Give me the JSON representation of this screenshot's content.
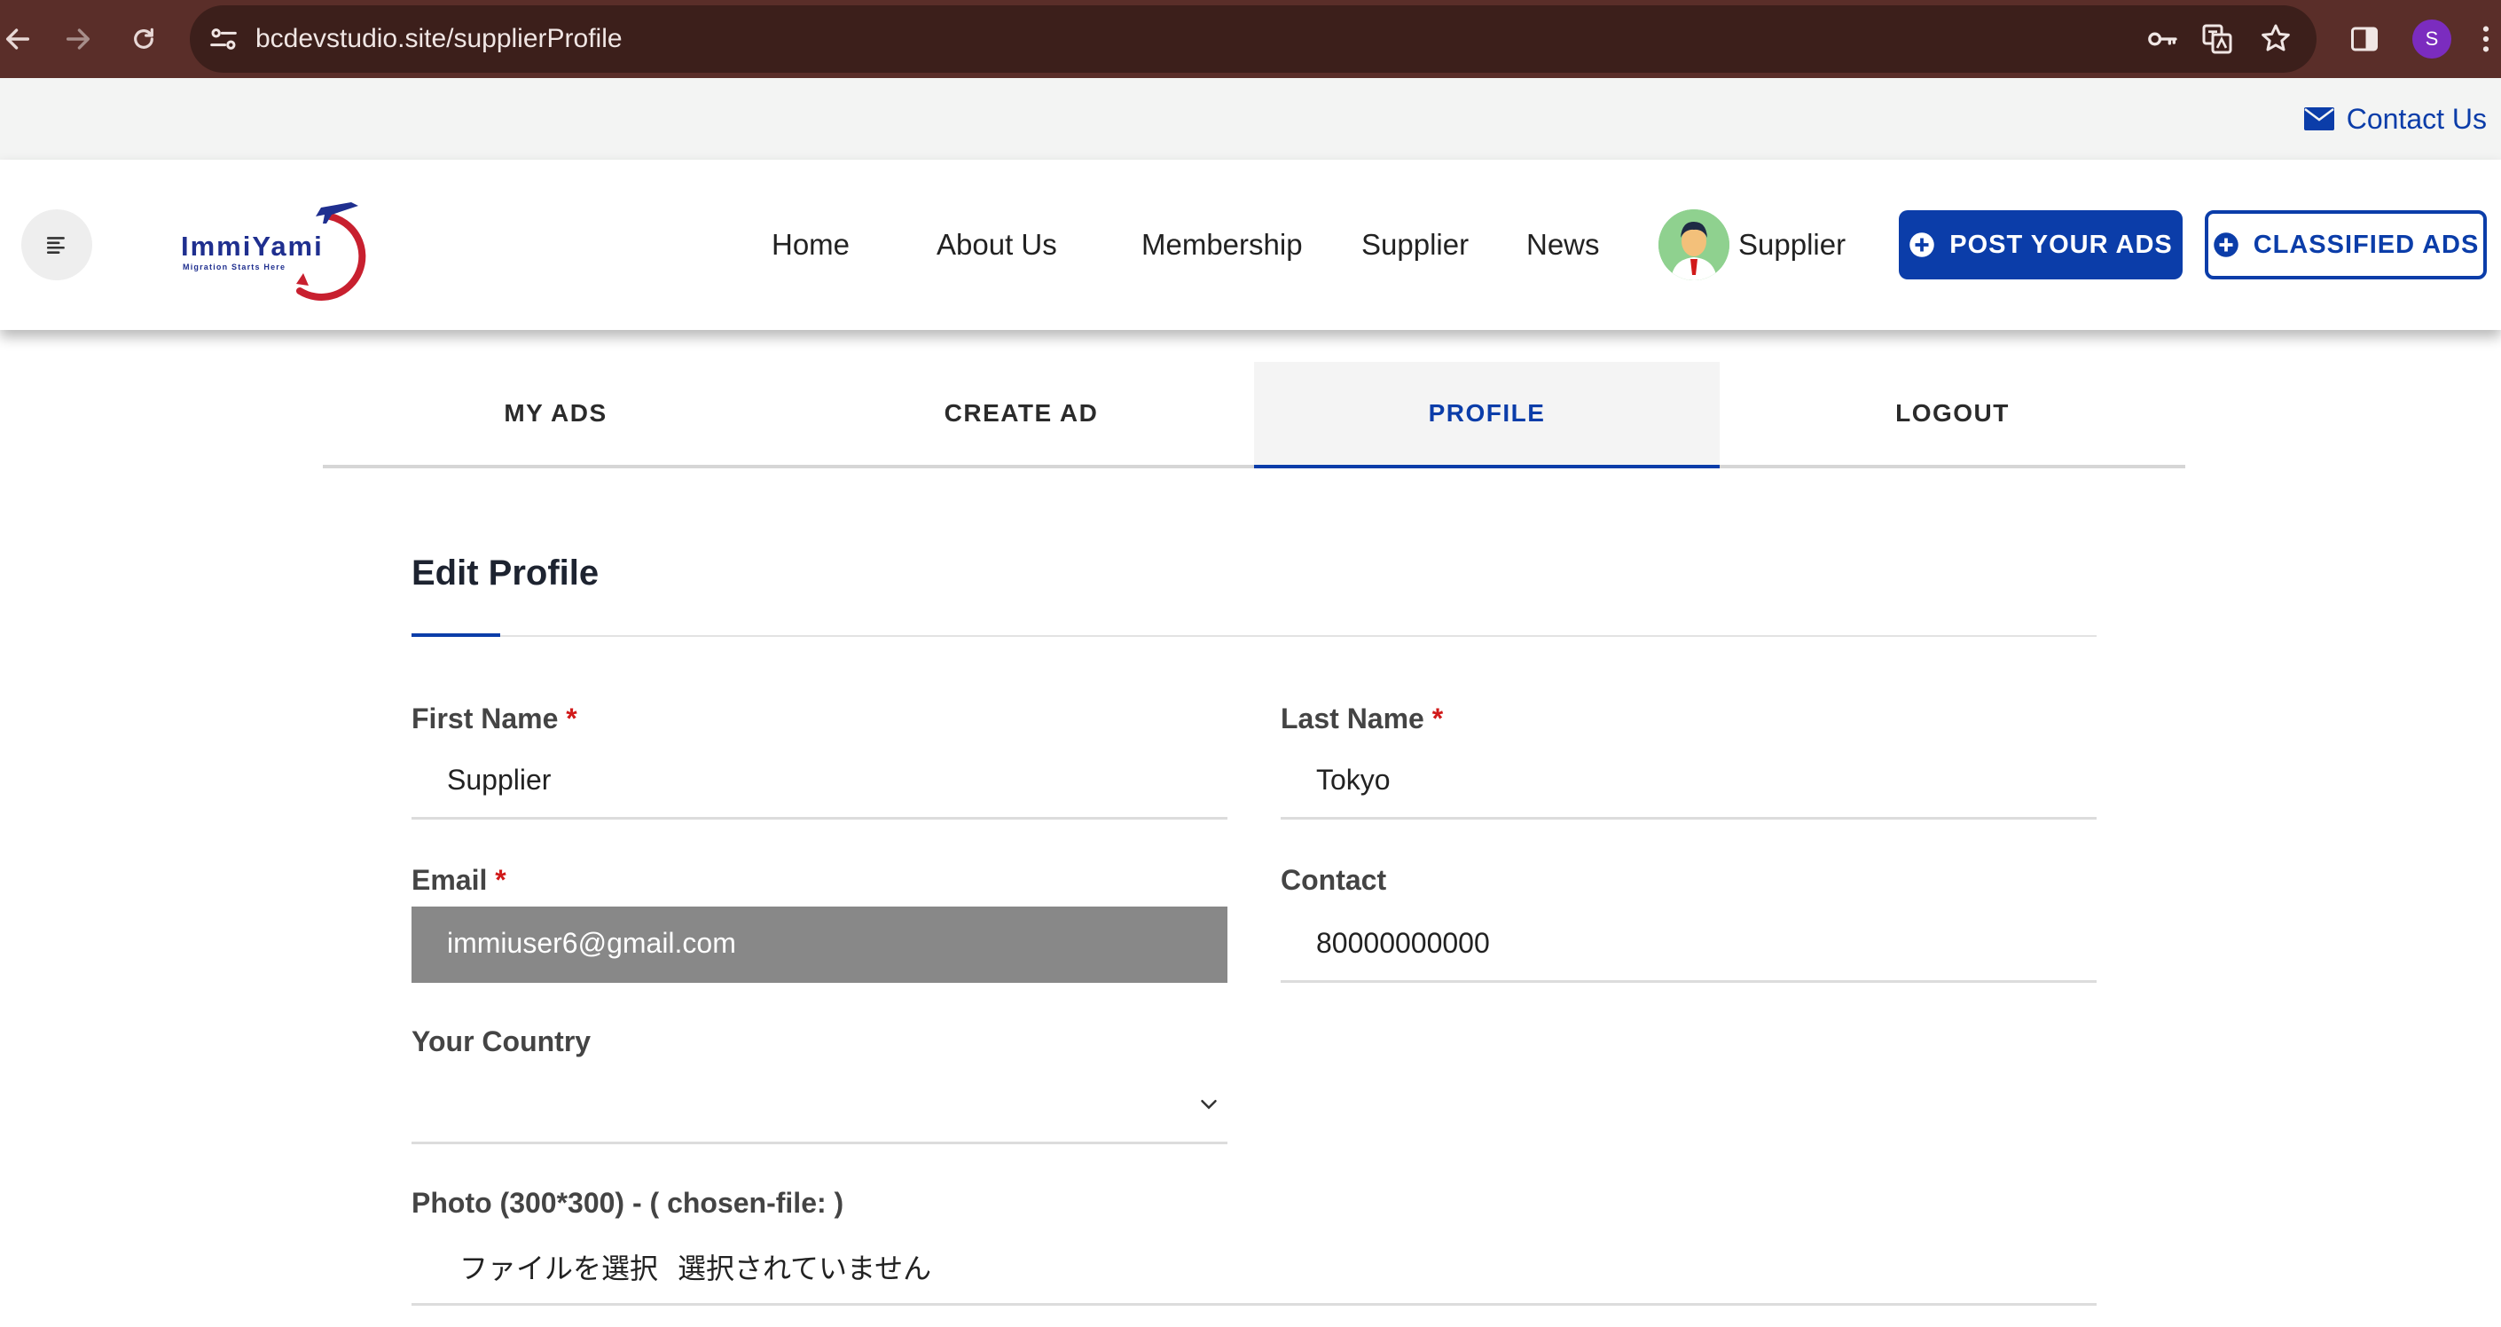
{
  "browser": {
    "url": "bcdevstudio.site/supplierProfile",
    "profile_initial": "S",
    "icons": [
      "back-icon",
      "forward-icon",
      "reload-icon",
      "site-settings-icon",
      "password-key-icon",
      "translate-icon",
      "bookmark-star-icon",
      "side-panel-icon",
      "menu-dots-icon"
    ]
  },
  "top_strip": {
    "contact_label": "Contact Us"
  },
  "header": {
    "logo_text": "ImmiYami",
    "logo_tagline": "Migration Starts Here",
    "nav": [
      "Home",
      "About Us",
      "Membership",
      "Supplier",
      "News"
    ],
    "user_label": "Supplier",
    "post_ads_label": "POST YOUR ADS",
    "classified_ads_label": "CLASSIFIED ADS"
  },
  "tabs": [
    {
      "label": "MY ADS",
      "active": false
    },
    {
      "label": "CREATE AD",
      "active": false
    },
    {
      "label": "PROFILE",
      "active": true
    },
    {
      "label": "LOGOUT",
      "active": false
    }
  ],
  "form": {
    "title": "Edit Profile",
    "first_name": {
      "label": "First Name",
      "required_mark": "*",
      "value": "Supplier"
    },
    "last_name": {
      "label": "Last Name",
      "required_mark": "*",
      "value": "Tokyo"
    },
    "email": {
      "label": "Email",
      "required_mark": "*",
      "value": "immiuser6@gmail.com"
    },
    "contact": {
      "label": "Contact",
      "value": "80000000000"
    },
    "country": {
      "label": "Your Country",
      "value": ""
    },
    "photo": {
      "label": "Photo (300*300) - ( chosen-file: )",
      "button_label": "ファイルを選択",
      "status": "選択されていません"
    }
  },
  "colors": {
    "brand_blue": "#0b3da9",
    "browser_bar": "#5a2e29",
    "required_red": "#d11a1a"
  }
}
